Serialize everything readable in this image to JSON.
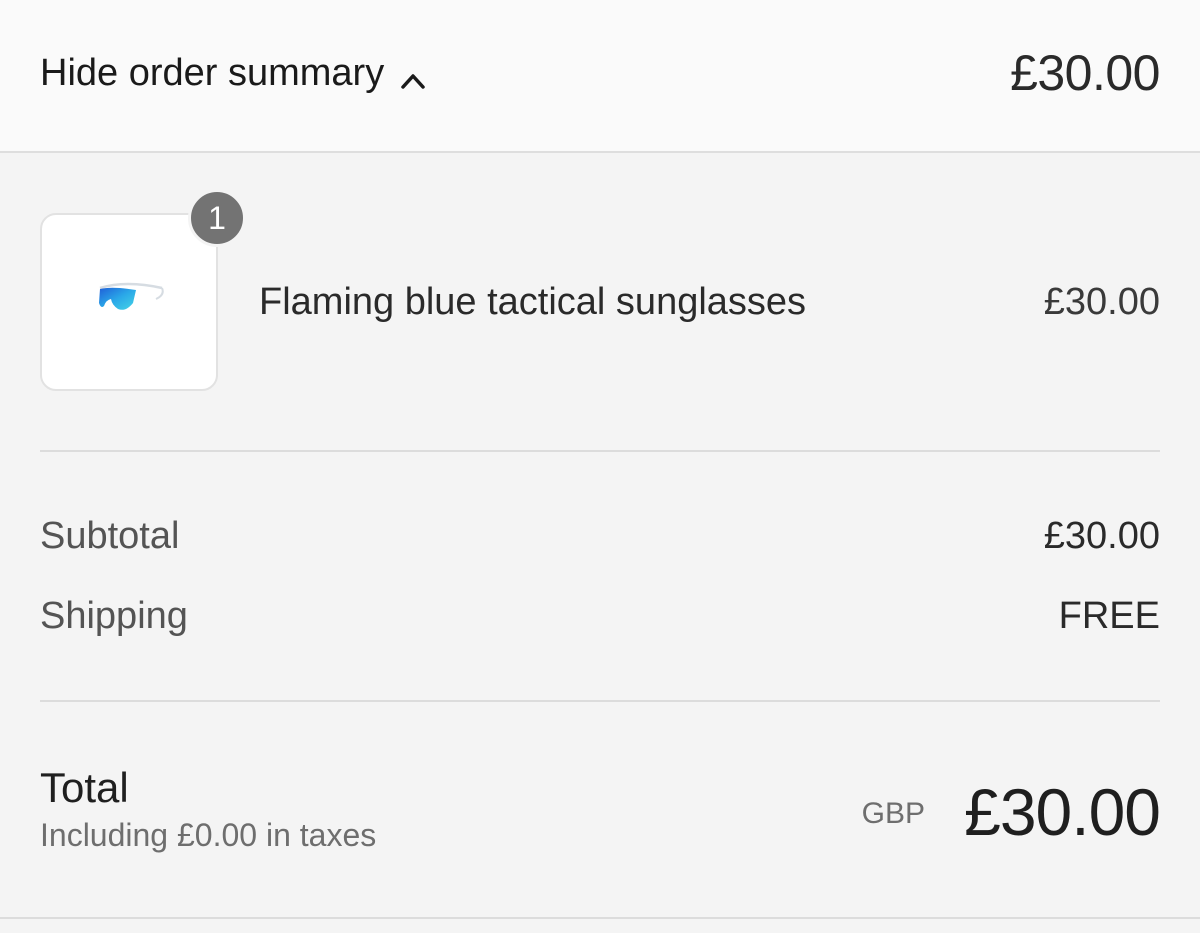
{
  "header": {
    "toggle_label": "Hide order summary",
    "total": "£30.00"
  },
  "item": {
    "quantity": "1",
    "name": "Flaming blue tactical sunglasses",
    "price": "£30.00",
    "image_icon": "sunglasses-image"
  },
  "summary": {
    "subtotal_label": "Subtotal",
    "subtotal_value": "£30.00",
    "shipping_label": "Shipping",
    "shipping_value": "FREE"
  },
  "total": {
    "label": "Total",
    "tax_note": "Including £0.00 in taxes",
    "currency": "GBP",
    "amount": "£30.00"
  },
  "colors": {
    "background": "#f4f4f4",
    "header_background": "#fafafa",
    "badge": "#737373",
    "lens_blue": "#2aa8e8"
  }
}
